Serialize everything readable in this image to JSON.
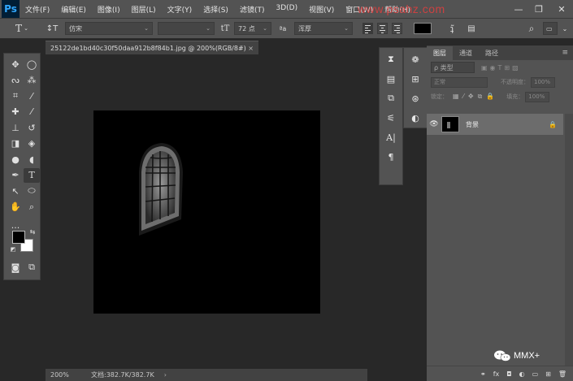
{
  "app": {
    "logo": "Ps",
    "menus": [
      "文件(F)",
      "编辑(E)",
      "图像(I)",
      "图层(L)",
      "文字(Y)",
      "选择(S)",
      "滤镜(T)",
      "3D(D)",
      "视图(V)",
      "窗口(W)",
      "帮助(H)"
    ],
    "watermark": "www.psahz.com",
    "window_controls": {
      "minimize": "—",
      "restore": "❐",
      "close": "✕"
    }
  },
  "options": {
    "tool_icon": "type-tool-icon",
    "tool_letter": "T",
    "orientation_icon": "text-orientation-icon",
    "font_family": "仿宋",
    "font_style": "",
    "size_icon": "font-size-icon",
    "font_size": "72 点",
    "aa_label": "ªa",
    "anti_alias": "浑厚",
    "align": [
      "left",
      "center",
      "right"
    ],
    "text_color": "#000000",
    "warp_icon": "warp-text-icon",
    "panels_icon": "character-panel-icon"
  },
  "toolbox": {
    "tools": [
      {
        "name": "move-tool-icon",
        "glyph": "✥"
      },
      {
        "name": "marquee-tool-icon",
        "glyph": "◯"
      },
      {
        "name": "lasso-tool-icon",
        "glyph": "ᔓ"
      },
      {
        "name": "quick-select-tool-icon",
        "glyph": "⁂"
      },
      {
        "name": "crop-tool-icon",
        "glyph": "⌗"
      },
      {
        "name": "eyedropper-tool-icon",
        "glyph": "⁄"
      },
      {
        "name": "healing-brush-tool-icon",
        "glyph": "✚"
      },
      {
        "name": "brush-tool-icon",
        "glyph": "⁄"
      },
      {
        "name": "clone-stamp-tool-icon",
        "glyph": "⊥"
      },
      {
        "name": "history-brush-tool-icon",
        "glyph": "↺"
      },
      {
        "name": "eraser-tool-icon",
        "glyph": "◨"
      },
      {
        "name": "paint-bucket-tool-icon",
        "glyph": "◈"
      },
      {
        "name": "blur-tool-icon",
        "glyph": "●"
      },
      {
        "name": "dodge-tool-icon",
        "glyph": "◖"
      },
      {
        "name": "pen-tool-icon",
        "glyph": "✒"
      },
      {
        "name": "type-tool-icon",
        "glyph": "T"
      },
      {
        "name": "path-select-tool-icon",
        "glyph": "↖"
      },
      {
        "name": "ellipse-shape-tool-icon",
        "glyph": "⬭"
      },
      {
        "name": "hand-tool-icon",
        "glyph": "✋"
      },
      {
        "name": "zoom-tool-icon",
        "glyph": "⌕"
      },
      {
        "name": "more-tools-icon",
        "glyph": "···"
      }
    ],
    "active_tool": "type-tool-icon",
    "foreground": "#000000",
    "background": "#ffffff"
  },
  "document": {
    "tab_title": "25122de1bd40c30f50daa912b8f84b1.jpg @ 200%(RGB/8#)",
    "close": "×",
    "zoom": "200%",
    "doc_info": "文档:382.7K/382.7K",
    "status_arrow": "›",
    "canvas_color": "#000000"
  },
  "strips": {
    "left": [
      "history-icon",
      "info-icon",
      "navigator-icon",
      "properties-icon",
      "character-icon",
      "paragraph-icon"
    ],
    "right": [
      "color-wheel-icon",
      "grid-swatches-icon",
      "libraries-icon",
      "adjustments-icon"
    ]
  },
  "layers_panel": {
    "tabs": [
      "图层",
      "通道",
      "路径"
    ],
    "active_tab": "图层",
    "menu": "≡",
    "filter_label": "ρ 类型",
    "blend_mode": "正常",
    "opacity_label": "不透明度：",
    "opacity": "100%",
    "lock_label": "锁定：",
    "fill_label": "填充：",
    "fill": "100%",
    "layers": [
      {
        "name": "背景",
        "visible": true,
        "locked": true
      }
    ],
    "bottom_actions": [
      "link-layers-icon",
      "fx-icon",
      "mask-icon",
      "adjustment-layer-icon",
      "group-icon",
      "new-layer-icon",
      "trash-icon"
    ],
    "bottom_glyphs": [
      "⚭",
      "fx",
      "◘",
      "◐",
      "▭",
      "⊞",
      "🗑"
    ]
  },
  "social": {
    "label": "MMX+"
  }
}
